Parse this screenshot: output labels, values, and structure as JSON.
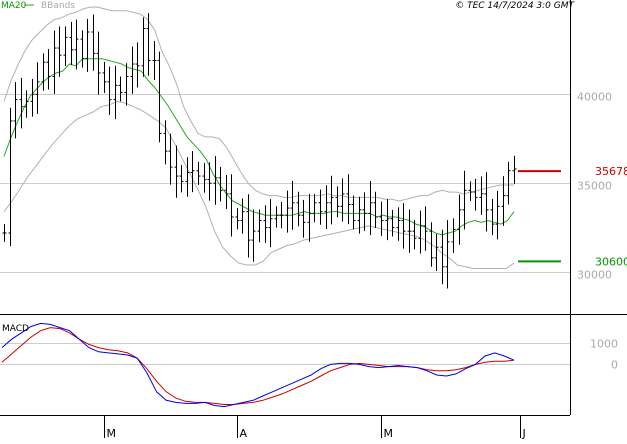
{
  "header": {
    "ma_label": "MA20",
    "bands_label": "BBands",
    "copyright": "© TEC 14/7/2024 3:0 GMT"
  },
  "colors": {
    "price_bar": "#000000",
    "ma": "#22aa22",
    "bands": "#b0b0b0",
    "macd_line": "#0000ee",
    "signal_line": "#cc0000",
    "resistance": "#cc0000",
    "support": "#009900",
    "grid": "#cccccc",
    "axis_text": "#aaaaaa"
  },
  "chart_data": [
    {
      "type": "ohlc",
      "name": "price-panel",
      "ylim": [
        27700,
        45300
      ],
      "y_ticks": [
        {
          "value": 30000,
          "label": "30000"
        },
        {
          "value": 35000,
          "label": "35000"
        },
        {
          "value": 40000,
          "label": "40000"
        }
      ],
      "x_labels": [
        {
          "label": "M",
          "index": 18
        },
        {
          "label": "A",
          "index": 42
        },
        {
          "label": "M",
          "index": 68
        },
        {
          "label": "J",
          "index": 93
        },
        {
          "label": "J",
          "index": 117
        }
      ],
      "levels": [
        {
          "label": "35678",
          "value": 35678,
          "kind": "resistance"
        },
        {
          "label": "30600",
          "value": 30600,
          "kind": "support"
        }
      ],
      "close": [
        32200,
        38500,
        39700,
        39300,
        39600,
        40000,
        40700,
        41800,
        41000,
        42600,
        42200,
        43200,
        42500,
        43100,
        42000,
        43500,
        42300,
        41200,
        40700,
        39700,
        40500,
        40100,
        41000,
        41700,
        41600,
        43700,
        41900,
        41900,
        37800,
        36800,
        35900,
        35400,
        35100,
        35600,
        35700,
        35400,
        35200,
        35000,
        35300,
        34600,
        34400,
        33100,
        32900,
        33400,
        31800,
        32300,
        32900,
        32500,
        33000,
        33200,
        33200,
        33600,
        33900,
        33200,
        32800,
        33300,
        33900,
        33400,
        33900,
        34200,
        33700,
        34400,
        33800,
        32900,
        33500,
        33300,
        33900,
        33100,
        32900,
        33000,
        32500,
        32900,
        32300,
        32300,
        31900,
        32600,
        32300,
        30800,
        31400,
        30300,
        31700,
        32400,
        33500,
        34600,
        34500,
        34200,
        34400,
        33500,
        32700,
        33700,
        34300,
        35700,
        35800
      ],
      "ma20": [
        36500,
        37500,
        38400,
        39200,
        39900,
        40300,
        40700,
        41000,
        41200,
        41300,
        41700,
        41600,
        42000,
        42000,
        42000,
        42000,
        41900,
        41800,
        41700,
        41500,
        41400,
        41300,
        40800,
        40400,
        39900,
        39400,
        38800,
        38200,
        37600,
        37200,
        36800,
        36300,
        35500,
        34900,
        34400,
        34000,
        33800,
        33600,
        33400,
        33300,
        33200,
        33200,
        33200,
        33200,
        33200,
        33300,
        33400,
        33300,
        33300,
        33300,
        33400,
        33400,
        33300,
        33300,
        33300,
        33300,
        33300,
        33100,
        33200,
        33100,
        33100,
        33000,
        32900,
        32700,
        32600,
        32400,
        32200,
        32100,
        32200,
        32300,
        32600,
        32800,
        32900,
        32800,
        32900,
        32800,
        32700,
        32900,
        33400
      ],
      "bb_upper": [
        39600,
        40800,
        41700,
        42500,
        43100,
        43500,
        43900,
        44200,
        44300,
        44500,
        44600,
        44800,
        44900,
        44900,
        44800,
        44700,
        44700,
        44700,
        44600,
        44500,
        44200,
        43600,
        42400,
        41600,
        40600,
        39300,
        38500,
        37800,
        37600,
        37600,
        37500,
        37000,
        36300,
        35600,
        35000,
        34600,
        34400,
        34300,
        34300,
        34200,
        34200,
        34300,
        34300,
        34300,
        34300,
        34400,
        34300,
        34300,
        34200,
        34200,
        34200,
        34200,
        34200,
        34100,
        34100,
        34000,
        34100,
        34200,
        34300,
        34300,
        34500,
        34600,
        34500,
        34500,
        34400,
        34500,
        34600,
        34700,
        34800,
        34900,
        34900,
        34900
      ],
      "bb_lower": [
        33400,
        34000,
        34700,
        35400,
        36000,
        36600,
        37200,
        37700,
        38200,
        38600,
        38800,
        39000,
        39300,
        39400,
        39600,
        39500,
        39300,
        39100,
        38800,
        38500,
        38100,
        37300,
        36400,
        35500,
        34600,
        33600,
        32300,
        31400,
        30900,
        30500,
        30400,
        30400,
        30600,
        31100,
        31300,
        31500,
        31600,
        31800,
        31900,
        32000,
        32100,
        32200,
        32300,
        32400,
        32500,
        32600,
        32500,
        32400,
        32300,
        32200,
        32100,
        32000,
        31800,
        31500,
        31100,
        30800,
        30400,
        30300,
        30200,
        30200,
        30200,
        30200,
        30200,
        30500
      ]
    },
    {
      "type": "line",
      "name": "macd-panel",
      "title": "MACD",
      "ylim": [
        -2400,
        2300
      ],
      "y_ticks": [
        {
          "value": 1000,
          "label": "1000"
        },
        {
          "value": 0,
          "label": "0"
        }
      ],
      "series": [
        {
          "name": "MACD",
          "values": [
            800,
            1200,
            1500,
            1800,
            1950,
            1900,
            1750,
            1600,
            1200,
            800,
            600,
            550,
            500,
            450,
            300,
            -400,
            -1300,
            -1700,
            -1800,
            -1850,
            -1850,
            -1800,
            -1950,
            -2000,
            -1900,
            -1800,
            -1700,
            -1500,
            -1300,
            -1100,
            -900,
            -700,
            -500,
            -200,
            0,
            50,
            50,
            0,
            -100,
            -150,
            -100,
            -50,
            -100,
            -150,
            -300,
            -500,
            -550,
            -450,
            -200,
            0,
            400,
            550,
            400,
            200
          ]
        },
        {
          "name": "Signal",
          "values": [
            100,
            500,
            900,
            1300,
            1600,
            1750,
            1700,
            1500,
            1200,
            950,
            800,
            700,
            650,
            550,
            300,
            -200,
            -800,
            -1300,
            -1600,
            -1750,
            -1800,
            -1800,
            -1850,
            -1900,
            -1900,
            -1850,
            -1800,
            -1700,
            -1550,
            -1400,
            -1200,
            -1000,
            -800,
            -550,
            -300,
            -150,
            0,
            50,
            0,
            -50,
            -100,
            -100,
            -100,
            -150,
            -250,
            -300,
            -300,
            -250,
            -150,
            0,
            100,
            150,
            150,
            200
          ]
        }
      ]
    }
  ]
}
